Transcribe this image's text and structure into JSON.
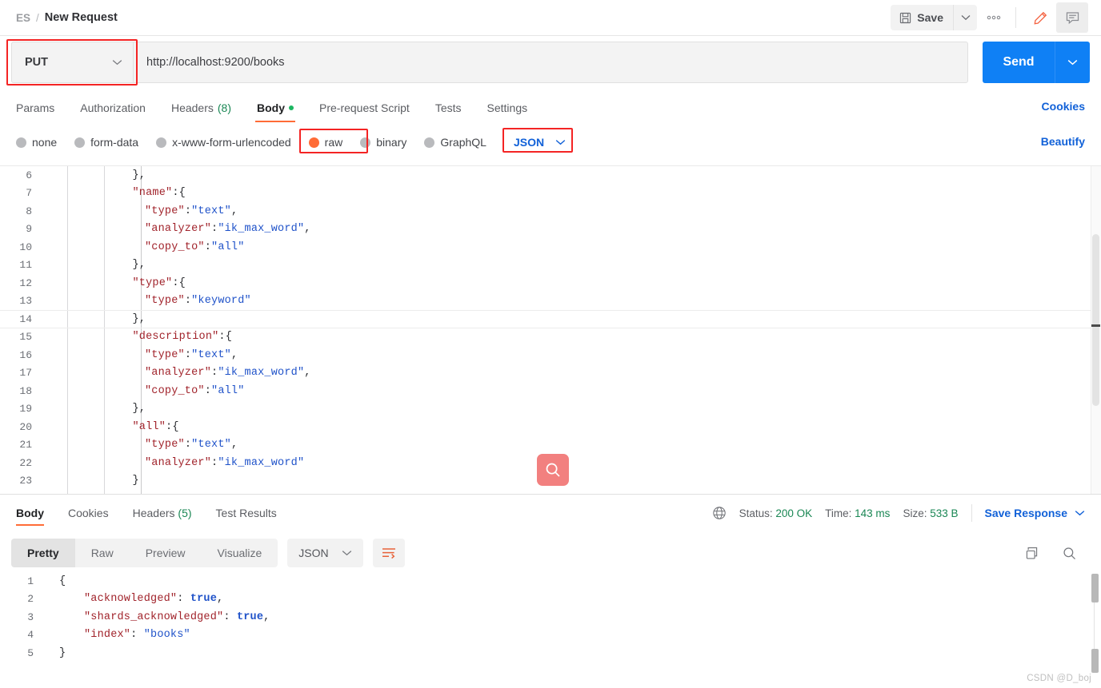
{
  "header": {
    "collection": "ES",
    "separator": "/",
    "request_name": "New Request",
    "save_label": "Save",
    "dots_label": "•••"
  },
  "request": {
    "method": "PUT",
    "url": "http://localhost:9200/books",
    "send_label": "Send",
    "tabs": [
      {
        "label": "Params",
        "active": false
      },
      {
        "label": "Authorization",
        "active": false
      },
      {
        "label": "Headers",
        "count": "(8)",
        "active": false
      },
      {
        "label": "Body",
        "active": true,
        "dot": true
      },
      {
        "label": "Pre-request Script",
        "active": false
      },
      {
        "label": "Tests",
        "active": false
      },
      {
        "label": "Settings",
        "active": false
      }
    ],
    "cookies_link": "Cookies",
    "beautify_link": "Beautify",
    "body_types": [
      {
        "label": "none",
        "selected": false
      },
      {
        "label": "form-data",
        "selected": false
      },
      {
        "label": "x-www-form-urlencoded",
        "selected": false
      },
      {
        "label": "raw",
        "selected": true
      },
      {
        "label": "binary",
        "selected": false
      },
      {
        "label": "GraphQL",
        "selected": false
      }
    ],
    "format": "JSON"
  },
  "request_body": {
    "lines": [
      {
        "no": "6",
        "indent": 3,
        "tokens": [
          {
            "t": "},",
            "c": "p"
          }
        ]
      },
      {
        "no": "7",
        "indent": 3,
        "tokens": [
          {
            "t": "\"name\"",
            "c": "k"
          },
          {
            "t": ":{",
            "c": "p"
          }
        ]
      },
      {
        "no": "8",
        "indent": 4,
        "tokens": [
          {
            "t": "\"type\"",
            "c": "k"
          },
          {
            "t": ":",
            "c": "p"
          },
          {
            "t": "\"text\"",
            "c": "s"
          },
          {
            "t": ",",
            "c": "p"
          }
        ]
      },
      {
        "no": "9",
        "indent": 4,
        "tokens": [
          {
            "t": "\"analyzer\"",
            "c": "k"
          },
          {
            "t": ":",
            "c": "p"
          },
          {
            "t": "\"ik_max_word\"",
            "c": "s"
          },
          {
            "t": ",",
            "c": "p"
          }
        ]
      },
      {
        "no": "10",
        "indent": 4,
        "tokens": [
          {
            "t": "\"copy_to\"",
            "c": "k"
          },
          {
            "t": ":",
            "c": "p"
          },
          {
            "t": "\"all\"",
            "c": "s"
          }
        ]
      },
      {
        "no": "11",
        "indent": 3,
        "tokens": [
          {
            "t": "},",
            "c": "p"
          }
        ]
      },
      {
        "no": "12",
        "indent": 3,
        "tokens": [
          {
            "t": "\"type\"",
            "c": "k"
          },
          {
            "t": ":{",
            "c": "p"
          }
        ]
      },
      {
        "no": "13",
        "indent": 4,
        "tokens": [
          {
            "t": "\"type\"",
            "c": "k"
          },
          {
            "t": ":",
            "c": "p"
          },
          {
            "t": "\"keyword\"",
            "c": "s"
          }
        ]
      },
      {
        "no": "14",
        "indent": 3,
        "tokens": [
          {
            "t": "},",
            "c": "p"
          }
        ]
      },
      {
        "no": "15",
        "indent": 3,
        "tokens": [
          {
            "t": "\"description\"",
            "c": "k"
          },
          {
            "t": ":{",
            "c": "p"
          }
        ]
      },
      {
        "no": "16",
        "indent": 4,
        "tokens": [
          {
            "t": "\"type\"",
            "c": "k"
          },
          {
            "t": ":",
            "c": "p"
          },
          {
            "t": "\"text\"",
            "c": "s"
          },
          {
            "t": ",",
            "c": "p"
          }
        ]
      },
      {
        "no": "17",
        "indent": 4,
        "tokens": [
          {
            "t": "\"analyzer\"",
            "c": "k"
          },
          {
            "t": ":",
            "c": "p"
          },
          {
            "t": "\"ik_max_word\"",
            "c": "s"
          },
          {
            "t": ",",
            "c": "p"
          }
        ]
      },
      {
        "no": "18",
        "indent": 4,
        "tokens": [
          {
            "t": "\"copy_to\"",
            "c": "k"
          },
          {
            "t": ":",
            "c": "p"
          },
          {
            "t": "\"all\"",
            "c": "s"
          }
        ]
      },
      {
        "no": "19",
        "indent": 3,
        "tokens": [
          {
            "t": "},",
            "c": "p"
          }
        ]
      },
      {
        "no": "20",
        "indent": 3,
        "tokens": [
          {
            "t": "\"all\"",
            "c": "k"
          },
          {
            "t": ":{",
            "c": "p"
          }
        ]
      },
      {
        "no": "21",
        "indent": 4,
        "tokens": [
          {
            "t": "\"type\"",
            "c": "k"
          },
          {
            "t": ":",
            "c": "p"
          },
          {
            "t": "\"text\"",
            "c": "s"
          },
          {
            "t": ",",
            "c": "p"
          }
        ]
      },
      {
        "no": "22",
        "indent": 4,
        "tokens": [
          {
            "t": "\"analyzer\"",
            "c": "k"
          },
          {
            "t": ":",
            "c": "p"
          },
          {
            "t": "\"ik_max_word\"",
            "c": "s"
          }
        ]
      },
      {
        "no": "23",
        "indent": 3,
        "tokens": [
          {
            "t": "}",
            "c": "p"
          }
        ]
      }
    ]
  },
  "response": {
    "tabs": [
      {
        "label": "Body",
        "active": true
      },
      {
        "label": "Cookies",
        "active": false
      },
      {
        "label": "Headers",
        "count": "(5)",
        "active": false
      },
      {
        "label": "Test Results",
        "active": false
      }
    ],
    "status_label": "Status:",
    "status_value": "200 OK",
    "time_label": "Time:",
    "time_value": "143 ms",
    "size_label": "Size:",
    "size_value": "533 B",
    "save_response": "Save Response",
    "view_modes": [
      {
        "label": "Pretty",
        "active": true
      },
      {
        "label": "Raw",
        "active": false
      },
      {
        "label": "Preview",
        "active": false
      },
      {
        "label": "Visualize",
        "active": false
      }
    ],
    "format": "JSON",
    "body_lines": [
      {
        "no": "1",
        "indent": 0,
        "tokens": [
          {
            "t": "{",
            "c": "p"
          }
        ]
      },
      {
        "no": "2",
        "indent": 1,
        "tokens": [
          {
            "t": "\"acknowledged\"",
            "c": "k"
          },
          {
            "t": ": ",
            "c": "p"
          },
          {
            "t": "true",
            "c": "b"
          },
          {
            "t": ",",
            "c": "p"
          }
        ]
      },
      {
        "no": "3",
        "indent": 1,
        "tokens": [
          {
            "t": "\"shards_acknowledged\"",
            "c": "k"
          },
          {
            "t": ": ",
            "c": "p"
          },
          {
            "t": "true",
            "c": "b"
          },
          {
            "t": ",",
            "c": "p"
          }
        ]
      },
      {
        "no": "4",
        "indent": 1,
        "tokens": [
          {
            "t": "\"index\"",
            "c": "k"
          },
          {
            "t": ": ",
            "c": "p"
          },
          {
            "t": "\"books\"",
            "c": "s"
          }
        ]
      },
      {
        "no": "5",
        "indent": 0,
        "tokens": [
          {
            "t": "}",
            "c": "p"
          }
        ]
      }
    ]
  },
  "watermark": "CSDN @D_boj",
  "colors": {
    "accent_orange": "#ff6c37",
    "link_blue": "#1161d8",
    "send_blue": "#0f80f5",
    "status_green": "#1a8754",
    "highlight_red": "#f42424",
    "fab_salmon": "#f2807f"
  }
}
